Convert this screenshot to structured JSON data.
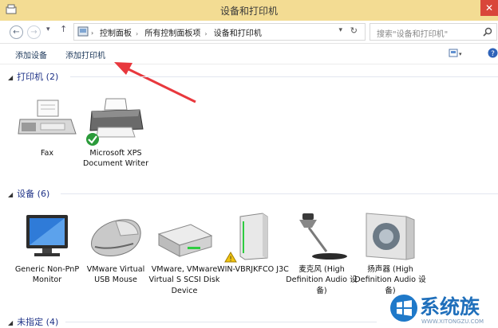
{
  "window": {
    "title": "设备和打印机",
    "close_label": "✕"
  },
  "address": {
    "breadcrumbs": [
      "控制面板",
      "所有控制面板项",
      "设备和打印机"
    ],
    "refresh_icon": "refresh-icon",
    "search_placeholder": "搜索\"设备和打印机\""
  },
  "toolbar": {
    "add_device": "添加设备",
    "add_printer": "添加打印机"
  },
  "groups": {
    "printers": {
      "label": "打印机 (2)"
    },
    "devices": {
      "label": "设备 (6)"
    },
    "unspecified": {
      "label": "未指定 (4)"
    }
  },
  "printers": [
    {
      "label": "Fax",
      "icon": "fax-icon"
    },
    {
      "label": "Microsoft XPS Document Writer",
      "icon": "printer-icon",
      "badge": "default-check-icon"
    }
  ],
  "devices": [
    {
      "label": "Generic Non-PnP Monitor",
      "icon": "monitor-icon"
    },
    {
      "label": "VMware Virtual USB Mouse",
      "icon": "mouse-icon"
    },
    {
      "label": "VMware, VMware Virtual S SCSI Disk Device",
      "icon": "disk-drive-icon"
    },
    {
      "label": "WIN-VBRJKFCO J3C",
      "icon": "computer-tower-icon",
      "badge": "warning-icon"
    },
    {
      "label": "麦克风 (High Definition Audio 设备)",
      "icon": "microphone-icon"
    },
    {
      "label": "扬声器 (High Definition Audio 设备)",
      "icon": "speaker-icon"
    }
  ],
  "watermark": {
    "text": "系统族",
    "url": "WWW.XITONGZU.COM"
  },
  "colors": {
    "titlebar": "#f3dc93",
    "group_text": "#1e3287",
    "arrow": "#e8383d",
    "close": "#d9463a"
  }
}
